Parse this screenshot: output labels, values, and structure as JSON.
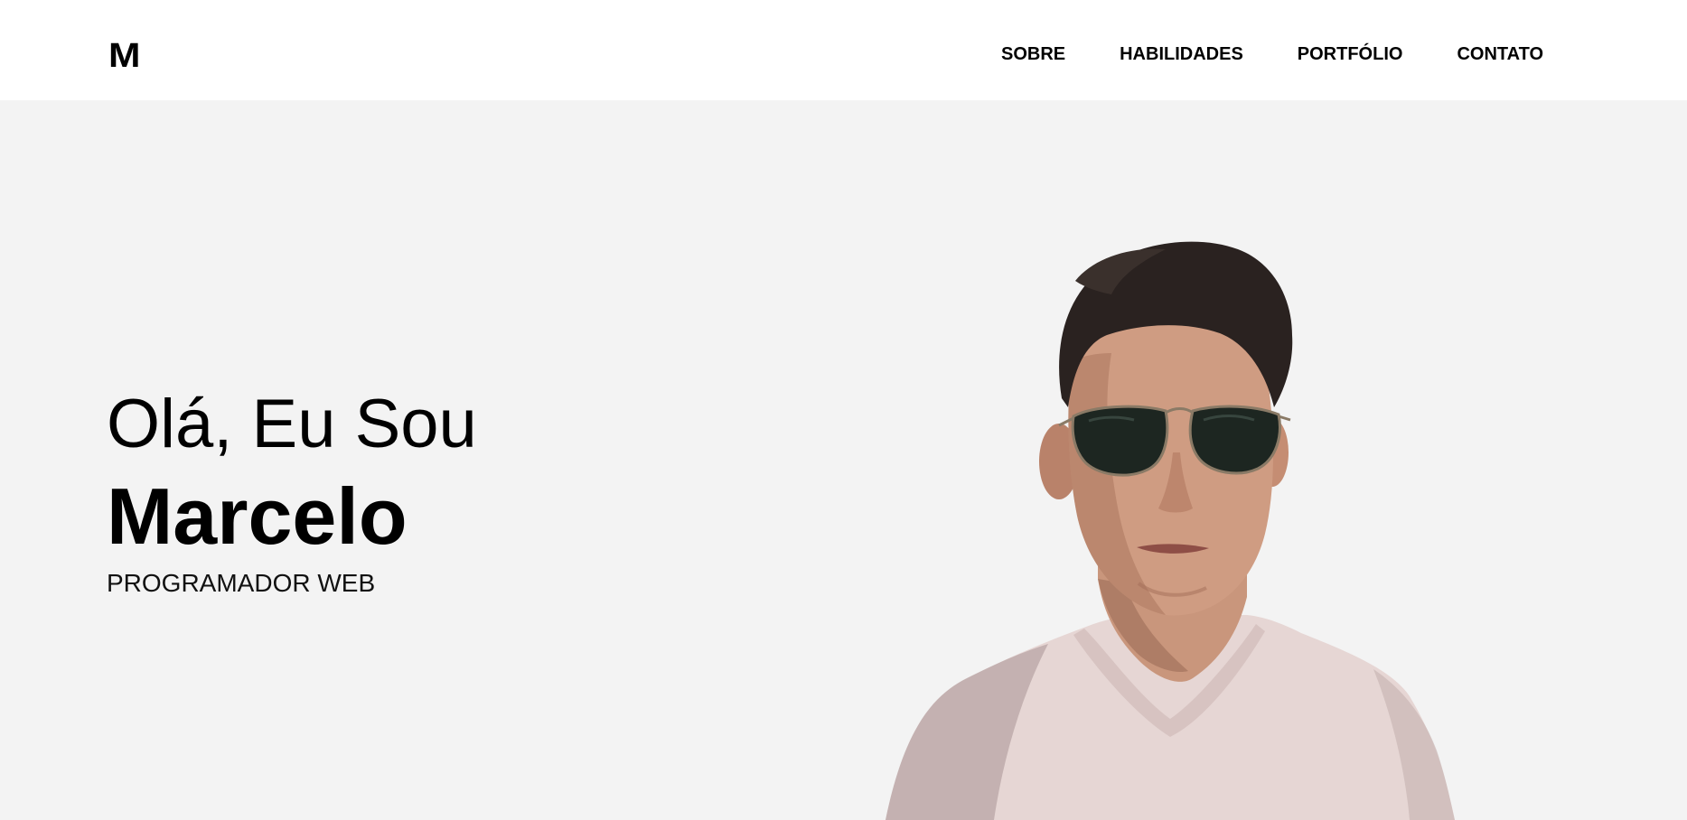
{
  "header": {
    "logo": "M",
    "nav": [
      {
        "label": "SOBRE"
      },
      {
        "label": "HABILIDADES"
      },
      {
        "label": "PORTFÓLIO"
      },
      {
        "label": "CONTATO"
      }
    ]
  },
  "hero": {
    "greeting": "Olá, Eu Sou",
    "name": "Marcelo",
    "role": "PROGRAMADOR WEB"
  },
  "colors": {
    "header_bg": "#ffffff",
    "hero_bg": "#f3f3f3",
    "text": "#000000"
  }
}
